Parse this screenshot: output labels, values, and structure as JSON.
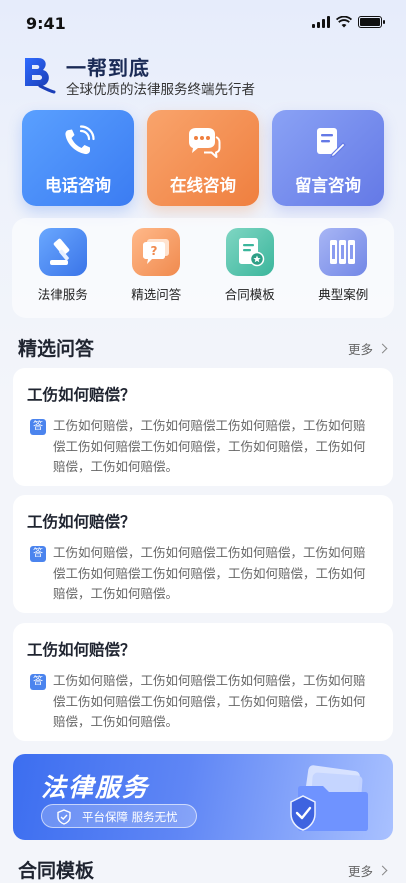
{
  "status_bar": {
    "time": "9:41"
  },
  "brand": {
    "name": "一帮到底",
    "slogan": "全球优质的法律服务终端先行者"
  },
  "consult": [
    {
      "label": "电话咨询",
      "icon": "phone-icon",
      "color": "#3b7cf2"
    },
    {
      "label": "在线咨询",
      "icon": "chat-icon",
      "color": "#ef7f3f"
    },
    {
      "label": "留言咨询",
      "icon": "note-icon",
      "color": "#6479e6"
    }
  ],
  "services": [
    {
      "label": "法律服务",
      "icon": "gavel-icon"
    },
    {
      "label": "精选问答",
      "icon": "question-chat-icon"
    },
    {
      "label": "合同模板",
      "icon": "contract-icon"
    },
    {
      "label": "典型案例",
      "icon": "books-icon"
    }
  ],
  "featured_qa": {
    "title": "精选问答",
    "more": "更多",
    "badge": "答",
    "items": [
      {
        "question": "工伤如何赔偿？",
        "answer": "工伤如何赔偿，工伤如何赔偿工伤如何赔偿，工伤如何赔偿工伤如何赔偿工伤如何赔偿，工伤如何赔偿，工伤如何赔偿，工伤如何赔偿。"
      },
      {
        "question": "工伤如何赔偿？",
        "answer": "工伤如何赔偿，工伤如何赔偿工伤如何赔偿，工伤如何赔偿工伤如何赔偿工伤如何赔偿，工伤如何赔偿，工伤如何赔偿，工伤如何赔偿。"
      },
      {
        "question": "工伤如何赔偿？",
        "answer": "工伤如何赔偿，工伤如何赔偿工伤如何赔偿，工伤如何赔偿工伤如何赔偿工伤如何赔偿，工伤如何赔偿，工伤如何赔偿，工伤如何赔偿。"
      }
    ]
  },
  "banner": {
    "title": "法律服务",
    "tagline": "平台保障 服务无忧"
  },
  "contract_section": {
    "title": "合同模板",
    "more": "更多"
  },
  "colors": {
    "accent": "#4b84ee",
    "page_bg": "#f3f5fa"
  }
}
